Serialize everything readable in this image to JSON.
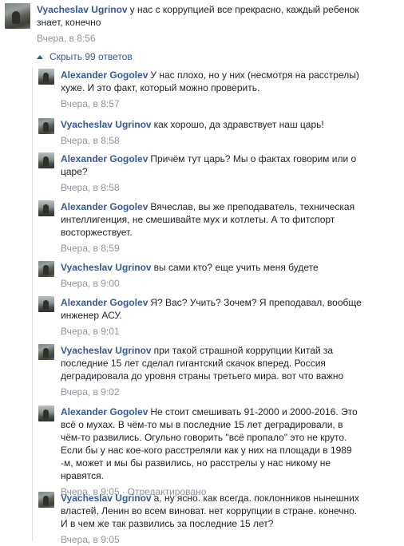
{
  "top_comment": {
    "author": "Vyacheslav Ugrinov",
    "text": "у нас с коррупцией все прекрасно, каждый ребенок знает, конечно",
    "time": "Вчера, в 8:56"
  },
  "replies_toggle": {
    "label": "Скрыть 99 ответов"
  },
  "replies": [
    {
      "author": "Alexander Gogolev",
      "text": "У нас плохо, но у них (несмотря на расстрелы) хуже. И это факт, который можно проверить.",
      "time": "Вчера, в 8:57",
      "edited": ""
    },
    {
      "author": "Vyacheslav Ugrinov",
      "text": "как хорошо, да здравствует наш царь!",
      "time": "Вчера, в 8:58",
      "edited": ""
    },
    {
      "author": "Alexander Gogolev",
      "text": "Причём тут царь? Мы о фактах говорим или о царе?",
      "time": "Вчера, в 8:58",
      "edited": ""
    },
    {
      "author": "Alexander Gogolev",
      "text": "Вячеслав, вы же преподаватель, техническая интеллигенция, не смешивайте мух и котлеты. А то фитспорт восторжествует.",
      "time": "Вчера, в 8:59",
      "edited": ""
    },
    {
      "author": "Vyacheslav Ugrinov",
      "text": "вы сами кто? еще учить меня будете",
      "time": "Вчера, в 9:00",
      "edited": ""
    },
    {
      "author": "Alexander Gogolev",
      "text": "Я? Вас? Учить? Зочем? Я преподавал, вообще инженер АСУ.",
      "time": "Вчера, в 9:01",
      "edited": ""
    },
    {
      "author": "Vyacheslav Ugrinov",
      "text": "при такой страшной коррупции Китай за последние 15 лет сделал гигантский скачок вперед. Россия деградировала до уровня страны третьего мира. вот что важно",
      "time": "Вчера, в 9:02",
      "edited": ""
    },
    {
      "author": "Alexander Gogolev",
      "text": "Не стоит смешивать 91-2000 и 2000-2016. Это всё о мухах. В чём-то мы в последние 15 лет деградировали, в чём-то развились. Огульно говорить \"всё пропало\" это не круто. Если бы у нас кое-кого расстреляли как у них на площади в 1989 -м, может и мы бы развились, но расстрелы у нас никому не нравятся.",
      "time": "Вчера, в 9:05",
      "edited": "Отредактировано"
    },
    {
      "author": "Vyacheslav Ugrinov",
      "text": "а, ну ясно. как всегда. поклонников нынешних властей, Ленин во всем виноват. нет коррупции в стране. конечно. И в чем же так развились за последние 15 лет?",
      "time": "Вчера, в 9:05",
      "edited": ""
    }
  ]
}
